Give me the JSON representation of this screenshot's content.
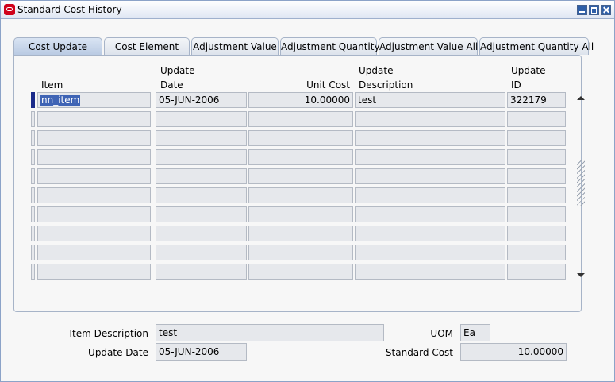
{
  "window": {
    "title": "Standard Cost History"
  },
  "tabs": [
    "Cost Update",
    "Cost Element",
    "Adjustment Value",
    "Adjustment Quantity",
    "Adjustment Value All",
    "Adjustment Quantity All"
  ],
  "columns": {
    "item": {
      "line1": "",
      "line2": "Item"
    },
    "update_date": {
      "line1": "Update",
      "line2": "Date"
    },
    "unit_cost": {
      "line1": "",
      "line2": "Unit Cost"
    },
    "update_description": {
      "line1": "Update",
      "line2": "Description"
    },
    "update_id": {
      "line1": "Update",
      "line2": "ID"
    }
  },
  "rows": [
    {
      "item": "nn_item",
      "update_date": "05-JUN-2006",
      "unit_cost": "10.00000",
      "update_description": "test",
      "update_id": "322179"
    },
    {
      "item": "",
      "update_date": "",
      "unit_cost": "",
      "update_description": "",
      "update_id": ""
    },
    {
      "item": "",
      "update_date": "",
      "unit_cost": "",
      "update_description": "",
      "update_id": ""
    },
    {
      "item": "",
      "update_date": "",
      "unit_cost": "",
      "update_description": "",
      "update_id": ""
    },
    {
      "item": "",
      "update_date": "",
      "unit_cost": "",
      "update_description": "",
      "update_id": ""
    },
    {
      "item": "",
      "update_date": "",
      "unit_cost": "",
      "update_description": "",
      "update_id": ""
    },
    {
      "item": "",
      "update_date": "",
      "unit_cost": "",
      "update_description": "",
      "update_id": ""
    },
    {
      "item": "",
      "update_date": "",
      "unit_cost": "",
      "update_description": "",
      "update_id": ""
    },
    {
      "item": "",
      "update_date": "",
      "unit_cost": "",
      "update_description": "",
      "update_id": ""
    },
    {
      "item": "",
      "update_date": "",
      "unit_cost": "",
      "update_description": "",
      "update_id": ""
    }
  ],
  "details": {
    "item_description": {
      "label": "Item Description",
      "value": "test"
    },
    "uom": {
      "label": "UOM",
      "value": "Ea"
    },
    "update_date": {
      "label": "Update Date",
      "value": "05-JUN-2006"
    },
    "standard_cost": {
      "label": "Standard Cost",
      "value": "10.00000"
    }
  }
}
